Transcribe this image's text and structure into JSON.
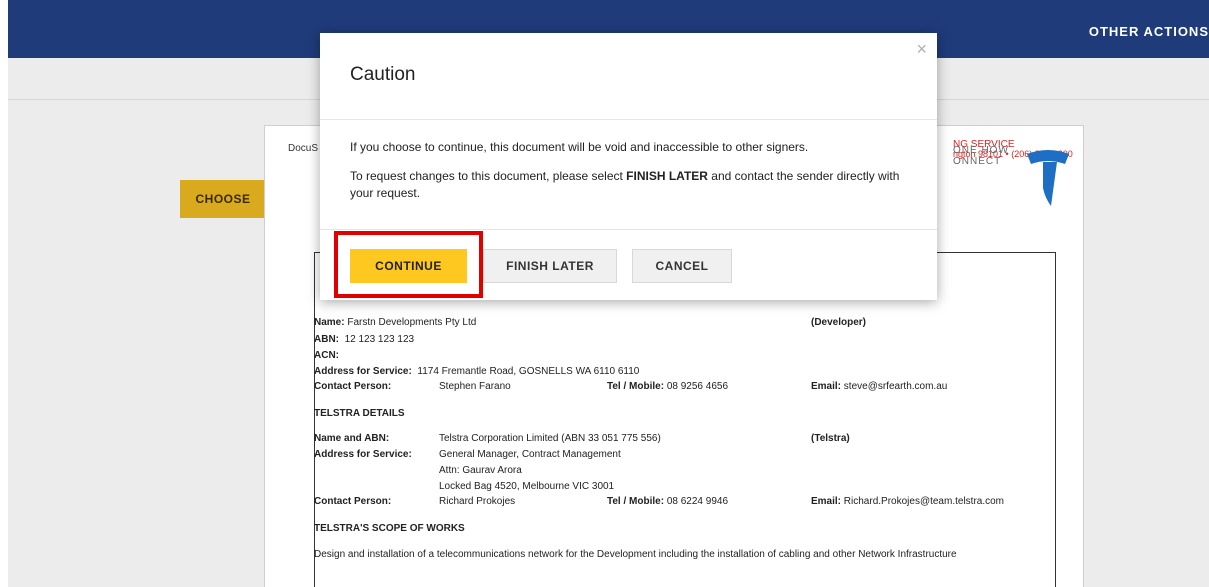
{
  "topbar": {
    "other_actions": "OTHER ACTIONS"
  },
  "document": {
    "docu_label": "DocuS",
    "header_red_1": "NG SERVICE",
    "header_red_2": "ngton 98101 • (206) 219-0200",
    "connect_1": "ONE HOW",
    "connect_2": "ONNECT",
    "tag_label": "CHOOSE",
    "developer": {
      "name_label": "Name:",
      "name_value": "Farstn Developments Pty Ltd",
      "developer_tag": "(Developer)",
      "abn_label": "ABN:",
      "abn_value": "12 123 123 123",
      "acn_label": "ACN:",
      "address_label": "Address for Service:",
      "address_value": "1174 Fremantle Road, GOSNELLS WA 6110 6110",
      "contact_label": "Contact Person:",
      "contact_value": "Stephen Farano",
      "tel_label": "Tel / Mobile:",
      "tel_value": "08 9256 4656",
      "email_label": "Email:",
      "email_value": "steve@srfearth.com.au"
    },
    "telstra_details_heading": "TELSTRA DETAILS",
    "telstra": {
      "name_label": "Name and ABN:",
      "name_value": "Telstra Corporation Limited (ABN 33 051 775 556)",
      "telstra_tag": "(Telstra)",
      "address_label": "Address for Service:",
      "address_line1": "General Manager, Contract Management",
      "address_line2": "Attn: Gaurav Arora",
      "address_line3": "Locked Bag 4520, Melbourne VIC 3001",
      "contact_label": "Contact Person:",
      "contact_value": "Richard Prokojes",
      "tel_label": "Tel / Mobile:",
      "tel_value": "08 6224 9946",
      "email_label": "Email:",
      "email_value": "Richard.Prokojes@team.telstra.com"
    },
    "scope_heading": "TELSTRA'S SCOPE OF WORKS",
    "scope_text": "Design and installation of a telecommunications network for the Development including the installation of cabling and other Network Infrastructure"
  },
  "modal": {
    "title": "Caution",
    "close_glyph": "×",
    "paragraph1": "If you choose to continue, this document will be void and inaccessible to other signers.",
    "paragraph2_prefix": "To request changes to this document, please select ",
    "paragraph2_bold": "FINISH LATER",
    "paragraph2_suffix": " and contact the sender directly with your request.",
    "continue_label": "CONTINUE",
    "finish_later_label": "FINISH LATER",
    "cancel_label": "CANCEL"
  },
  "colors": {
    "topbar": "#1f3b7a",
    "continue_button": "#ffc820",
    "choose_tag": "#d9aa1e",
    "highlight_border": "#e00000",
    "telstra_logo": "#1e6fc4"
  },
  "icons": {
    "close": "close-icon",
    "logo": "telstra-logo-icon"
  }
}
